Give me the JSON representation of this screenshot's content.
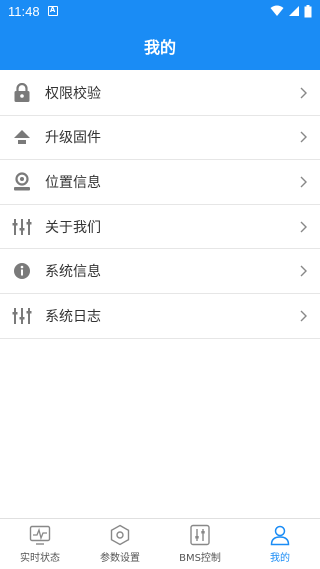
{
  "status": {
    "time": "11:48",
    "notification": "A"
  },
  "header": {
    "title": "我的"
  },
  "menu": {
    "items": [
      {
        "label": "权限校验",
        "icon": "lock-icon"
      },
      {
        "label": "升级固件",
        "icon": "upload-icon"
      },
      {
        "label": "位置信息",
        "icon": "location-icon"
      },
      {
        "label": "关于我们",
        "icon": "sliders-icon"
      },
      {
        "label": "系统信息",
        "icon": "info-icon"
      },
      {
        "label": "系统日志",
        "icon": "sliders-icon"
      }
    ]
  },
  "tabs": [
    {
      "label": "实时状态",
      "icon": "monitor-icon",
      "active": false
    },
    {
      "label": "参数设置",
      "icon": "hexagon-settings-icon",
      "active": false
    },
    {
      "label": "BMS控制",
      "icon": "control-panel-icon",
      "active": false
    },
    {
      "label": "我的",
      "icon": "user-icon",
      "active": true
    }
  ],
  "colors": {
    "primary": "#1a8cf5",
    "icon_gray": "#7a7a7a"
  }
}
